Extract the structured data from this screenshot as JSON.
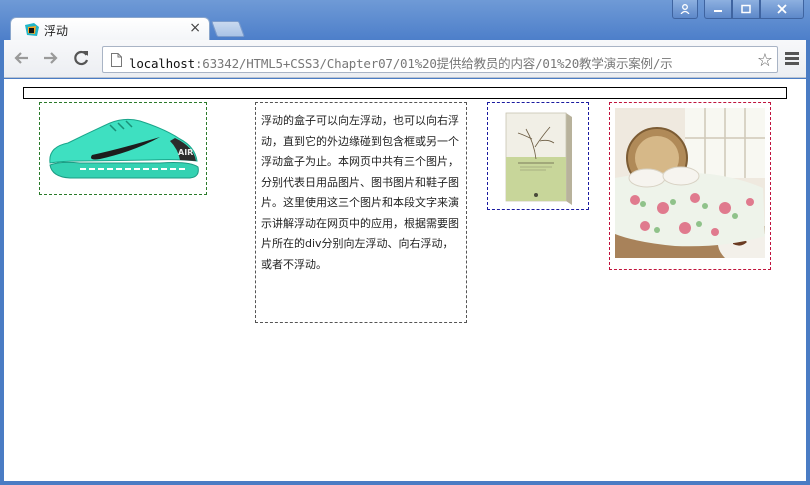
{
  "browser": {
    "tab_title": "浮动",
    "tab_close": "×",
    "url_host": "localhost",
    "url_path": ":63342/HTML5+CSS3/Chapter07/01%20提供给教员的内容/01%20教学演示案例/示",
    "window_buttons": {
      "user": "user-icon",
      "minimize": "minimize-icon",
      "maximize": "maximize-icon",
      "close": "close-icon"
    }
  },
  "toolbar": {
    "back": "back-icon",
    "forward": "forward-icon",
    "reload": "reload-icon",
    "star": "star-icon",
    "menu": "menu-icon"
  },
  "page": {
    "paragraph": "浮动的盒子可以向左浮动，也可以向右浮动，直到它的外边缘碰到包含框或另一个浮动盒子为止。本网页中共有三个图片，分别代表日用品图片、图书图片和鞋子图片。这里使用这三个图片和本段文字来演示讲解浮动在网页中的应用，根据需要图片所在的div分别向左浮动、向右浮动，或者不浮动。",
    "images": [
      "shoe-image",
      "book-image",
      "bed-image"
    ]
  },
  "colors": {
    "shoe_border": "#2a7a2a",
    "text_border": "#555555",
    "book_border": "#1a1aa0",
    "bed_border": "#c0123c"
  }
}
